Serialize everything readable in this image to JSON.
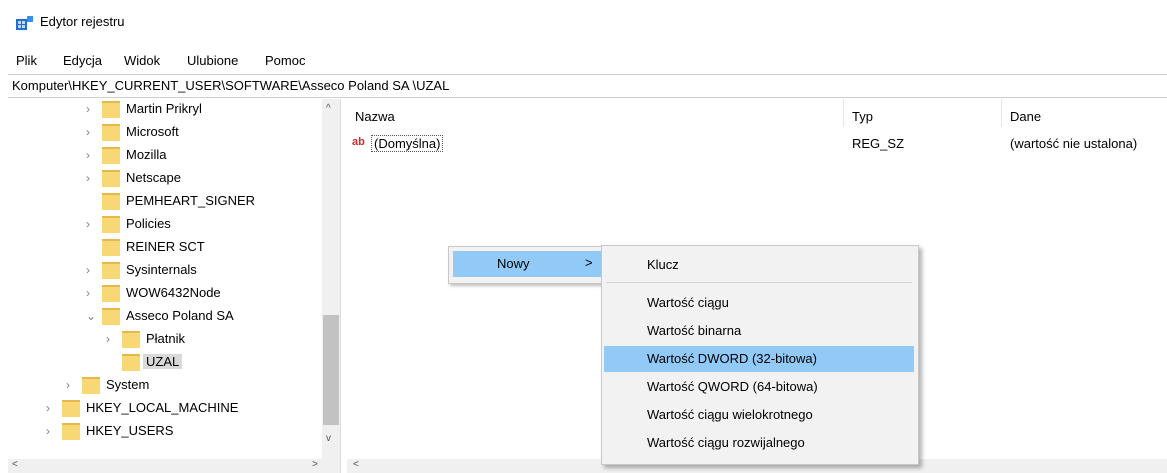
{
  "window": {
    "title": "Edytor rejestru"
  },
  "menu": [
    "Plik",
    "Edycja",
    "Widok",
    "Ulubione",
    "Pomoc"
  ],
  "address": "Komputer\\HKEY_CURRENT_USER\\SOFTWARE\\Asseco Poland SA \\UZAL",
  "tree": [
    {
      "label": "Martin Prikryl",
      "chev": "›"
    },
    {
      "label": "Microsoft",
      "chev": "›"
    },
    {
      "label": "Mozilla",
      "chev": "›"
    },
    {
      "label": "Netscape",
      "chev": "›"
    },
    {
      "label": "PEMHEART_SIGNER",
      "chev": ""
    },
    {
      "label": "Policies",
      "chev": "›"
    },
    {
      "label": "REINER SCT",
      "chev": ""
    },
    {
      "label": "Sysinternals",
      "chev": "›"
    },
    {
      "label": "WOW6432Node",
      "chev": "›"
    },
    {
      "label": "Asseco Poland SA",
      "chev": "⌄"
    },
    {
      "label": "Płatnik",
      "chev": "›"
    },
    {
      "label": "UZAL",
      "chev": ""
    },
    {
      "label": "System",
      "chev": "›"
    },
    {
      "label": "HKEY_LOCAL_MACHINE",
      "chev": "›"
    },
    {
      "label": "HKEY_USERS",
      "chev": "›"
    }
  ],
  "columns": {
    "name": "Nazwa",
    "type": "Typ",
    "data": "Dane"
  },
  "values": [
    {
      "icon": "ab",
      "name": "(Domyślna)",
      "type": "REG_SZ",
      "data": "(wartość nie ustalona)"
    }
  ],
  "context_menu": {
    "new_label": "Nowy",
    "new_arrow": ">"
  },
  "submenu": {
    "key": "Klucz",
    "items": [
      "Wartość ciągu",
      "Wartość binarna",
      "Wartość DWORD (32-bitowa)",
      "Wartość QWORD (64-bitowa)",
      "Wartość ciągu wielokrotnego",
      "Wartość ciągu rozwijalnego"
    ],
    "highlighted": "Wartość DWORD (32-bitowa)"
  },
  "scroll": {
    "left": "<",
    "right": ">",
    "up": "^",
    "down": "v"
  },
  "colors": {
    "highlight": "#91c9f7",
    "folder": "#f8d775"
  }
}
